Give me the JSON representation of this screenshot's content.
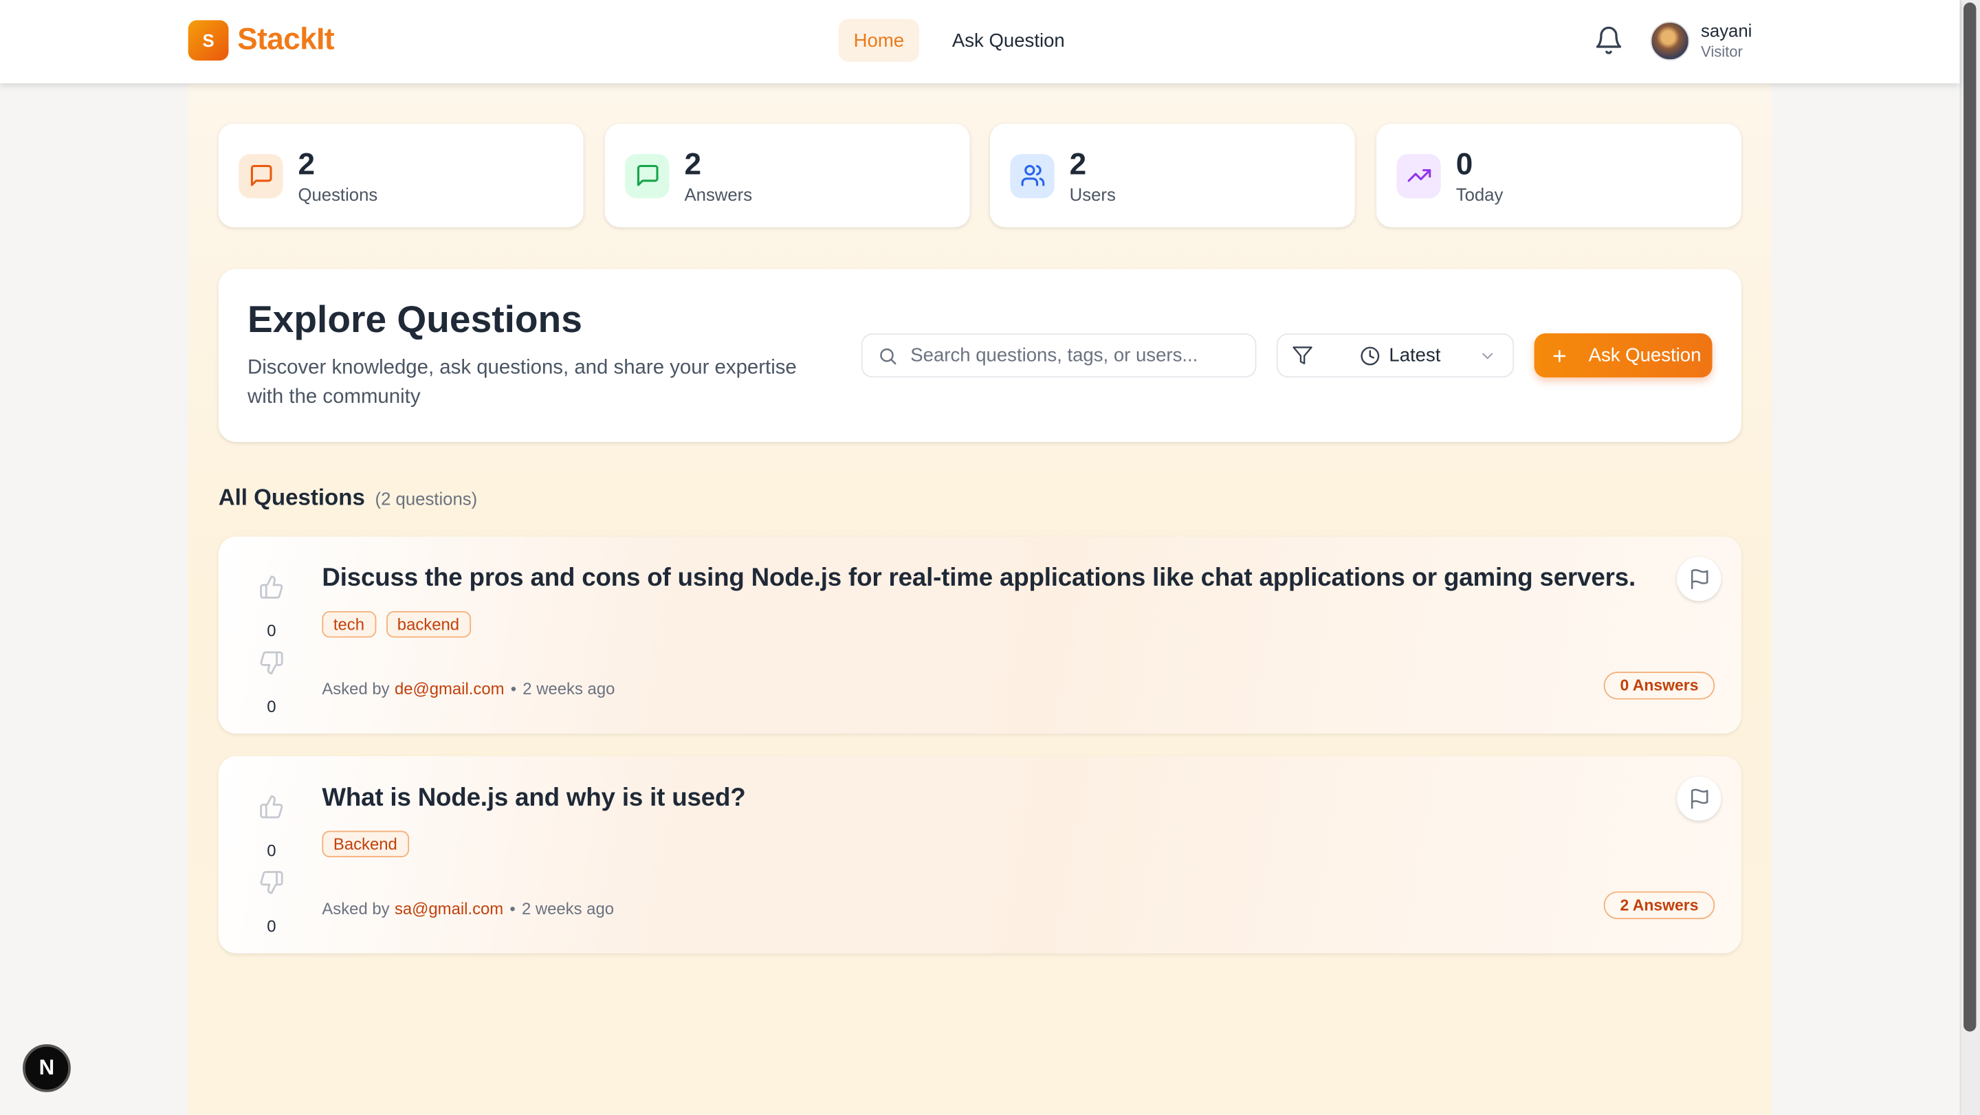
{
  "app": {
    "logo_letter": "S",
    "name": "StackIt",
    "brand_color": "#f07a18"
  },
  "nav": {
    "items": [
      {
        "label": "Home",
        "active": true
      },
      {
        "label": "Ask Question",
        "active": false
      }
    ]
  },
  "user": {
    "name": "sayani",
    "role": "Visitor"
  },
  "stats": [
    {
      "value": "2",
      "label": "Questions",
      "icon": "message-square-icon",
      "color": "#ea580c",
      "bg": "#fdebd9"
    },
    {
      "value": "2",
      "label": "Answers",
      "icon": "message-square-icon",
      "color": "#16a34a",
      "bg": "#dcfce7"
    },
    {
      "value": "2",
      "label": "Users",
      "icon": "users-icon",
      "color": "#2563eb",
      "bg": "#dbeafe"
    },
    {
      "value": "0",
      "label": "Today",
      "icon": "trending-up-icon",
      "color": "#9333ea",
      "bg": "#f3e8ff"
    }
  ],
  "explore": {
    "title": "Explore Questions",
    "subtitle": "Discover knowledge, ask questions, and share your expertise with the community",
    "search_placeholder": "Search questions, tags, or users...",
    "sort_label": "Latest",
    "ask_button": "Ask Question"
  },
  "list": {
    "title": "All Questions",
    "count_text": "(2 questions)"
  },
  "questions": [
    {
      "title": "Discuss the pros and cons of using Node.js for real-time applications like chat applications or gaming servers.",
      "tags": [
        "tech",
        "backend"
      ],
      "upvotes": "0",
      "downvotes": "0",
      "asked_by_prefix": "Asked by",
      "author": "de@gmail.com",
      "separator": "•",
      "time": "2 weeks ago",
      "answers": "0 Answers"
    },
    {
      "title": "What is Node.js and why is it used?",
      "tags": [
        "Backend"
      ],
      "upvotes": "0",
      "downvotes": "0",
      "asked_by_prefix": "Asked by",
      "author": "sa@gmail.com",
      "separator": "•",
      "time": "2 weeks ago",
      "answers": "2 Answers"
    }
  ],
  "dev_badge": "N"
}
